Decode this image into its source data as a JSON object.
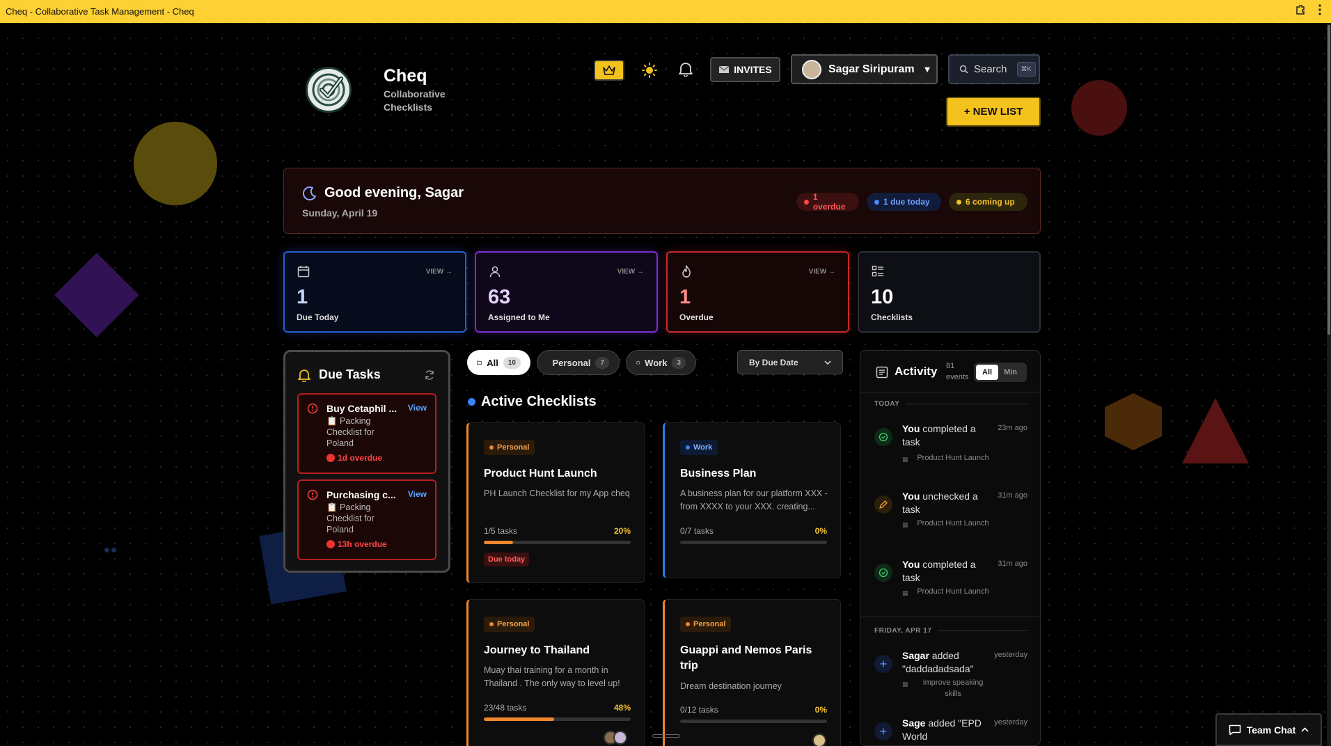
{
  "browser": {
    "title": "Cheq - Collaborative Task Management - Cheq"
  },
  "brand": {
    "name": "Cheq",
    "subtitle": "Collaborative Checklists"
  },
  "header": {
    "invites_label": "INVITES",
    "user_name": "Sagar Siripuram",
    "search_label": "Search",
    "search_shortcut": "⌘K",
    "new_list_label": "+ NEW LIST"
  },
  "greeting": {
    "text": "Good evening, Sagar",
    "date": "Sunday, April 19",
    "pills": {
      "overdue": "1 overdue",
      "due_today": "1 due today",
      "coming_up": "6 coming up"
    }
  },
  "stats": [
    {
      "value": "1",
      "label": "Due Today",
      "view": "VIEW →",
      "color": "#2b5ccf",
      "value_color": "#c9d8ff"
    },
    {
      "value": "63",
      "label": "Assigned to Me",
      "view": "VIEW →",
      "color": "#7a2fd1",
      "value_color": "#e6d2ff"
    },
    {
      "value": "1",
      "label": "Overdue",
      "view": "VIEW →",
      "color": "#c72929",
      "value_color": "#ff8a8a"
    },
    {
      "value": "10",
      "label": "Checklists",
      "view": "",
      "color": "#2b2f3a",
      "value_color": "#ffffff"
    }
  ],
  "due_tasks": {
    "title": "Due Tasks",
    "items": [
      {
        "title": "Buy Cetaphil ...",
        "view": "View",
        "list": "📋 Packing Checklist for Poland",
        "overdue": "1d overdue"
      },
      {
        "title": "Purchasing c...",
        "view": "View",
        "list": "📋 Packing Checklist for Poland",
        "overdue": "13h overdue"
      }
    ]
  },
  "filters": {
    "all": {
      "label": "All",
      "count": "10"
    },
    "personal": {
      "label": "Personal",
      "count": "7"
    },
    "work": {
      "label": "Work",
      "count": "3"
    },
    "sort": "By Due Date"
  },
  "section_title": "Active Checklists",
  "checklists": [
    {
      "tag": "Personal",
      "title": "Product Hunt Launch",
      "desc": "PH Launch Checklist for my App cheq",
      "tasks": "1/5 tasks",
      "percent": "20%",
      "progress": 0.2,
      "due": "Due today"
    },
    {
      "tag": "Work",
      "title": "Business Plan",
      "desc": "A business plan for our platform XXX - from XXXX to your XXX. creating...",
      "tasks": "0/7 tasks",
      "percent": "0%",
      "progress": 0
    },
    {
      "tag": "Personal",
      "title": "Journey to Thailand",
      "desc": "Muay thai training for a month in Thailand . The only way to level up!",
      "tasks": "23/48 tasks",
      "percent": "48%",
      "progress": 0.48
    },
    {
      "tag": "Personal",
      "title": "Guappi and Nemos Paris trip",
      "desc": "Dream destination journey",
      "tasks": "0/12 tasks",
      "percent": "0%",
      "progress": 0
    }
  ],
  "activity": {
    "title": "Activity",
    "count": "81 events",
    "toggle_all": "All",
    "toggle_min": "Min",
    "groups": [
      {
        "label": "TODAY"
      },
      {
        "label": "FRIDAY, APR 17"
      }
    ],
    "items": [
      {
        "user": "You",
        "action": " completed a task",
        "time": "23m ago",
        "list": "Product Hunt Launch"
      },
      {
        "user": "You",
        "action": " unchecked a task",
        "time": "31m ago",
        "list": "Product Hunt Launch"
      },
      {
        "user": "You",
        "action": " completed a task",
        "time": "31m ago",
        "list": "Product Hunt Launch"
      },
      {
        "user": "Sagar",
        "action": " added \"daddadadsada\"",
        "time": "yesterday",
        "list": "Improve speaking skills"
      },
      {
        "user": "Sage",
        "action": " added \"EPD World",
        "time": "yesterday",
        "list": ""
      }
    ]
  },
  "team_chat": {
    "label": "Team Chat"
  }
}
